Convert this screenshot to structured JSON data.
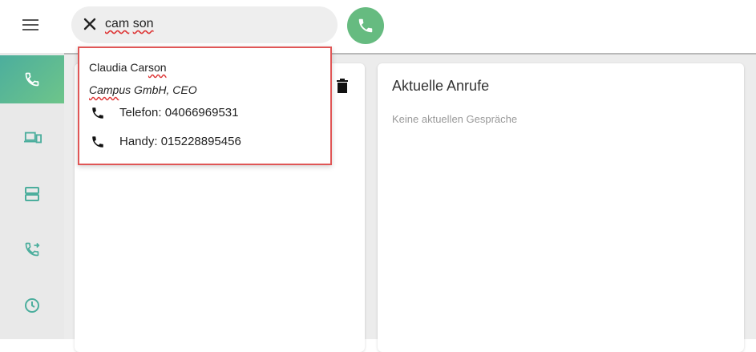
{
  "search": {
    "query_part1": "cam",
    "query_part2": "son"
  },
  "contact": {
    "name_prefix": "Claudia Car",
    "name_highlight": "son",
    "company_prefix": "Camp",
    "company_rest": "us GmbH, CEO",
    "phones": [
      {
        "label": "Telefon: 04066969531",
        "icon": "phone-icon"
      },
      {
        "label": "Handy: 015228895456",
        "icon": "phone-icon"
      }
    ]
  },
  "sidebar": {
    "items": [
      {
        "icon": "phone-icon",
        "active": true
      },
      {
        "icon": "devices-icon",
        "active": false
      },
      {
        "icon": "server-icon",
        "active": false
      },
      {
        "icon": "call-forward-icon",
        "active": false
      },
      {
        "icon": "clock-icon",
        "active": false
      }
    ]
  },
  "current_calls": {
    "title": "Aktuelle Anrufe",
    "empty": "Keine aktuellen Gespräche"
  },
  "colors": {
    "accent": "#66bb80",
    "highlight_border": "#e05656",
    "sidebar_bg": "#e9e9e9",
    "content_bg": "#ececec"
  }
}
